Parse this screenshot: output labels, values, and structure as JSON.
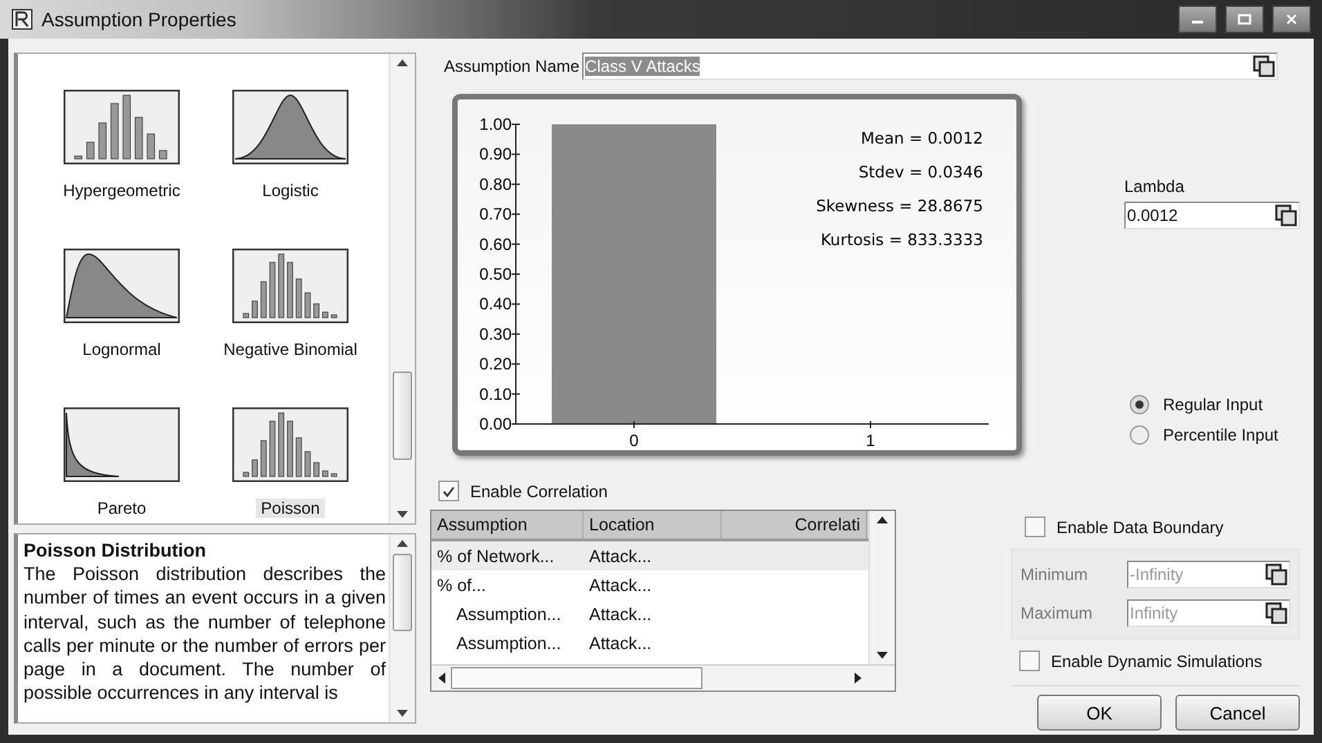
{
  "window": {
    "title": "Assumption Properties"
  },
  "gallery": {
    "items": [
      {
        "label": "Hypergeometric",
        "kind": "bars-symmetric",
        "selected": false
      },
      {
        "label": "Logistic",
        "kind": "bell",
        "selected": false
      },
      {
        "label": "Lognormal",
        "kind": "skewed",
        "selected": false
      },
      {
        "label": "Negative Binomial",
        "kind": "bars-skewed",
        "selected": false
      },
      {
        "label": "Pareto",
        "kind": "decay",
        "selected": false
      },
      {
        "label": "Poisson",
        "kind": "bars-skewed",
        "selected": true
      }
    ]
  },
  "description": {
    "title": "Poisson Distribution",
    "text": "The Poisson distribution describes the number of times an event occurs in a given interval, such as the number of telephone calls per minute or the number of errors per page in a document. The number of possible occurrences in any interval is"
  },
  "assumption_name": {
    "label": "Assumption Name",
    "value": "Class V Attacks"
  },
  "chart": {
    "stats": [
      "Mean = 0.0012",
      "Stdev = 0.0346",
      "Skewness = 28.8675",
      "Kurtosis = 833.3333"
    ],
    "chart_data": {
      "type": "bar",
      "categories": [
        "0",
        "1"
      ],
      "series": [
        {
          "color": "#8a8a8a",
          "values": [
            1,
            0
          ]
        }
      ],
      "ylim": [
        0,
        1
      ],
      "yticks": [
        {
          "value": 0,
          "label": "0.00"
        },
        {
          "value": 0.1,
          "label": "0.10"
        },
        {
          "value": 0.2,
          "label": "0.20"
        },
        {
          "value": 0.3,
          "label": "0.30"
        },
        {
          "value": 0.4,
          "label": "0.40"
        },
        {
          "value": 0.5,
          "label": "0.50"
        },
        {
          "value": 0.6,
          "label": "0.60"
        },
        {
          "value": 0.7,
          "label": "0.70"
        },
        {
          "value": 0.8,
          "label": "0.80"
        },
        {
          "value": 0.9,
          "label": "0.90"
        },
        {
          "value": 1,
          "label": "1.00"
        }
      ]
    }
  },
  "parameter": {
    "label": "Lambda",
    "value": "0.0012"
  },
  "input_mode": [
    {
      "label": "Regular Input",
      "selected": true
    },
    {
      "label": "Percentile Input",
      "selected": false
    }
  ],
  "correlation": {
    "label": "Enable Correlation",
    "checked": true,
    "columns": [
      "Assumption",
      "Location",
      "Correlati"
    ],
    "rows": [
      {
        "cells": [
          "% of Network...",
          "Attack..."
        ],
        "selected": true
      },
      {
        "cells": [
          "% of...",
          "Attack..."
        ],
        "selected": false,
        "children": [
          {
            "cells": [
              "Assumption...",
              "Attack..."
            ],
            "selected": false
          },
          {
            "cells": [
              "Assumption...",
              "Attack..."
            ],
            "selected": false
          }
        ]
      }
    ]
  },
  "data_boundary": {
    "label": "Enable Data Boundary",
    "checked": false,
    "disabled": true,
    "fields": [
      {
        "label": "Minimum",
        "value": "-Infinity"
      },
      {
        "label": "Maximum",
        "value": "Infinity"
      }
    ]
  },
  "dynamic_simulations": {
    "label": "Enable Dynamic Simulations",
    "checked": false
  },
  "buttons": [
    "OK",
    "Cancel"
  ]
}
